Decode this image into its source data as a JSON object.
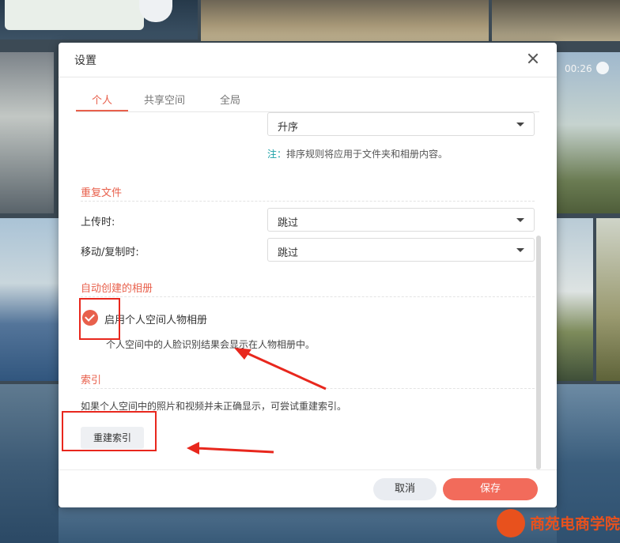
{
  "background": {
    "video_duration": "00:26"
  },
  "dialog": {
    "title": "设置",
    "tabs": [
      {
        "label": "个人",
        "active": true
      },
      {
        "label": "共享空间",
        "active": false
      },
      {
        "label": "全局",
        "active": false
      }
    ],
    "sort": {
      "order_value": "升序",
      "note_prefix": "注：",
      "note_text": "排序规则将应用于文件夹和相册内容。"
    },
    "duplicate_files": {
      "title": "重复文件",
      "upload_label": "上传时:",
      "upload_value": "跳过",
      "move_copy_label": "移动/复制时:",
      "move_copy_value": "跳过"
    },
    "auto_albums": {
      "title": "自动创建的相册",
      "enable_label": "启用个人空间人物相册",
      "enabled": true,
      "description": "个人空间中的人脸识别结果会显示在人物相册中。"
    },
    "index": {
      "title": "索引",
      "description": "如果个人空间中的照片和视频并未正确显示，可尝试重建索引。",
      "rebuild_label": "重建索引"
    },
    "footer": {
      "cancel_label": "取消",
      "save_label": "保存"
    }
  },
  "colors": {
    "accent": "#e8604c",
    "save_button": "#f26b5b",
    "note_prefix": "#1aa0a6",
    "annotation": "#e8271d"
  },
  "watermark": {
    "text": "商苑电商学院"
  }
}
